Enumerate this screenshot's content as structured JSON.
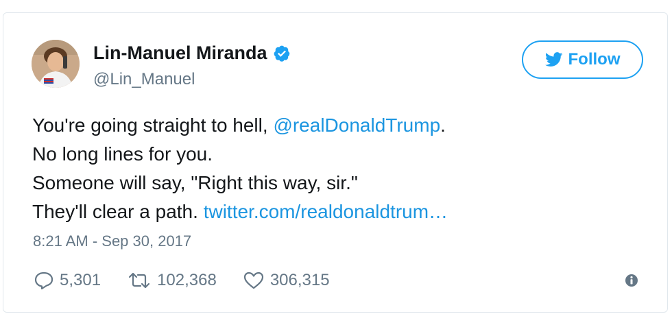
{
  "user": {
    "name": "Lin-Manuel Miranda",
    "handle": "@Lin_Manuel",
    "verified_icon": "verified-badge-icon",
    "avatar": "profile-photo"
  },
  "follow_button": {
    "label": "Follow",
    "icon": "twitter-bird-icon",
    "color": "#1da1f2"
  },
  "tweet": {
    "line1_prefix": "You're going straight to hell, ",
    "mention": "@realDonaldTrump",
    "line1_suffix": ".",
    "line2": "No long lines for you.",
    "line3": "Someone will say, \"Right this way, sir.\"",
    "line4_prefix": "They'll clear a path. ",
    "link": "twitter.com/realdonaldtrum…",
    "link_color": "#1b95e0"
  },
  "timestamp": "8:21 AM - Sep 30, 2017",
  "actions": {
    "replies": "5,301",
    "retweets": "102,368",
    "likes": "306,315"
  },
  "info_icon": "info-icon"
}
